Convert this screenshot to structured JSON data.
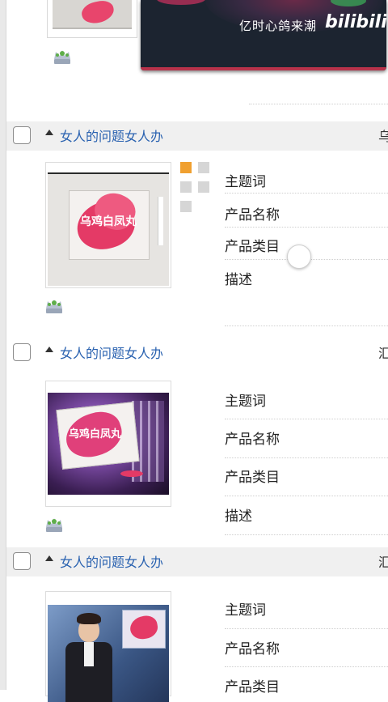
{
  "overlay": {
    "caption": "亿时心鸽来潮",
    "logo": "bilibili"
  },
  "cards": [
    {
      "title": "女人的问题女人办",
      "right_text": "乌",
      "fields": [
        "主题词",
        "产品名称",
        "产品类目",
        "描述"
      ],
      "image_text": "乌鸡白凤丸"
    },
    {
      "title": "女人的问题女人办",
      "right_text": "汇",
      "fields": [
        "主题词",
        "产品名称",
        "产品类目",
        "描述"
      ],
      "image_text": "乌鸡白凤丸"
    },
    {
      "title": "女人的问题女人办",
      "right_text": "汇",
      "fields": [
        "主题词",
        "产品名称",
        "产品类目"
      ]
    }
  ],
  "colors": {
    "link": "#2a62b0",
    "header_bg": "#f0f0f0",
    "accent_orange": "#f0a030",
    "petal": "#e43a66"
  },
  "icons": {
    "crown": "crown-icon",
    "caret": "caret-up-icon",
    "checkbox": "checkbox-unchecked-icon"
  }
}
